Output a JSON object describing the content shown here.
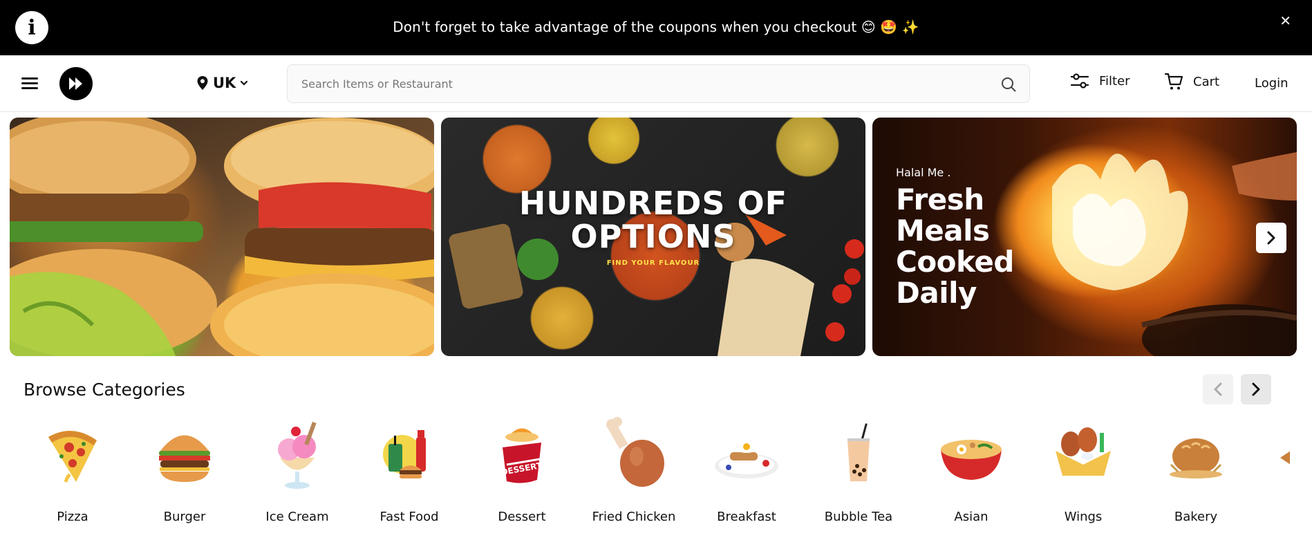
{
  "announcement": {
    "text": "Don't forget to take advantage of the coupons when you checkout 😊 🤩 ✨",
    "info_icon": "info-icon",
    "close": "✕"
  },
  "header": {
    "location": "UK",
    "search_placeholder": "Search Items or Restaurant",
    "filter_label": "Filter",
    "cart_label": "Cart",
    "login_label": "Login"
  },
  "banners": [
    {
      "name": "burger-banner"
    },
    {
      "name": "options-banner",
      "title_line1": "HUNDREDS OF",
      "title_line2": "OPTIONS",
      "subtitle": "FIND YOUR FLAVOUR"
    },
    {
      "name": "fresh-meals-banner",
      "brand": "Halal Me .",
      "line1": "Fresh",
      "line2": "Meals",
      "line3": "Cooked",
      "line4": "Daily"
    }
  ],
  "categories": {
    "title": "Browse Categories",
    "items": [
      {
        "label": "Pizza",
        "icon": "pizza-icon"
      },
      {
        "label": "Burger",
        "icon": "burger-icon"
      },
      {
        "label": "Ice Cream",
        "icon": "ice-cream-icon"
      },
      {
        "label": "Fast Food",
        "icon": "fast-food-icon"
      },
      {
        "label": "Dessert",
        "icon": "dessert-icon"
      },
      {
        "label": "Fried Chicken",
        "icon": "fried-chicken-icon"
      },
      {
        "label": "Breakfast",
        "icon": "breakfast-icon"
      },
      {
        "label": "Bubble Tea",
        "icon": "bubble-tea-icon"
      },
      {
        "label": "Asian",
        "icon": "asian-icon"
      },
      {
        "label": "Wings",
        "icon": "wings-icon"
      },
      {
        "label": "Bakery",
        "icon": "bakery-icon"
      }
    ]
  },
  "colors": {
    "bar": "#000000",
    "accent": "#000000",
    "text": "#111111"
  }
}
